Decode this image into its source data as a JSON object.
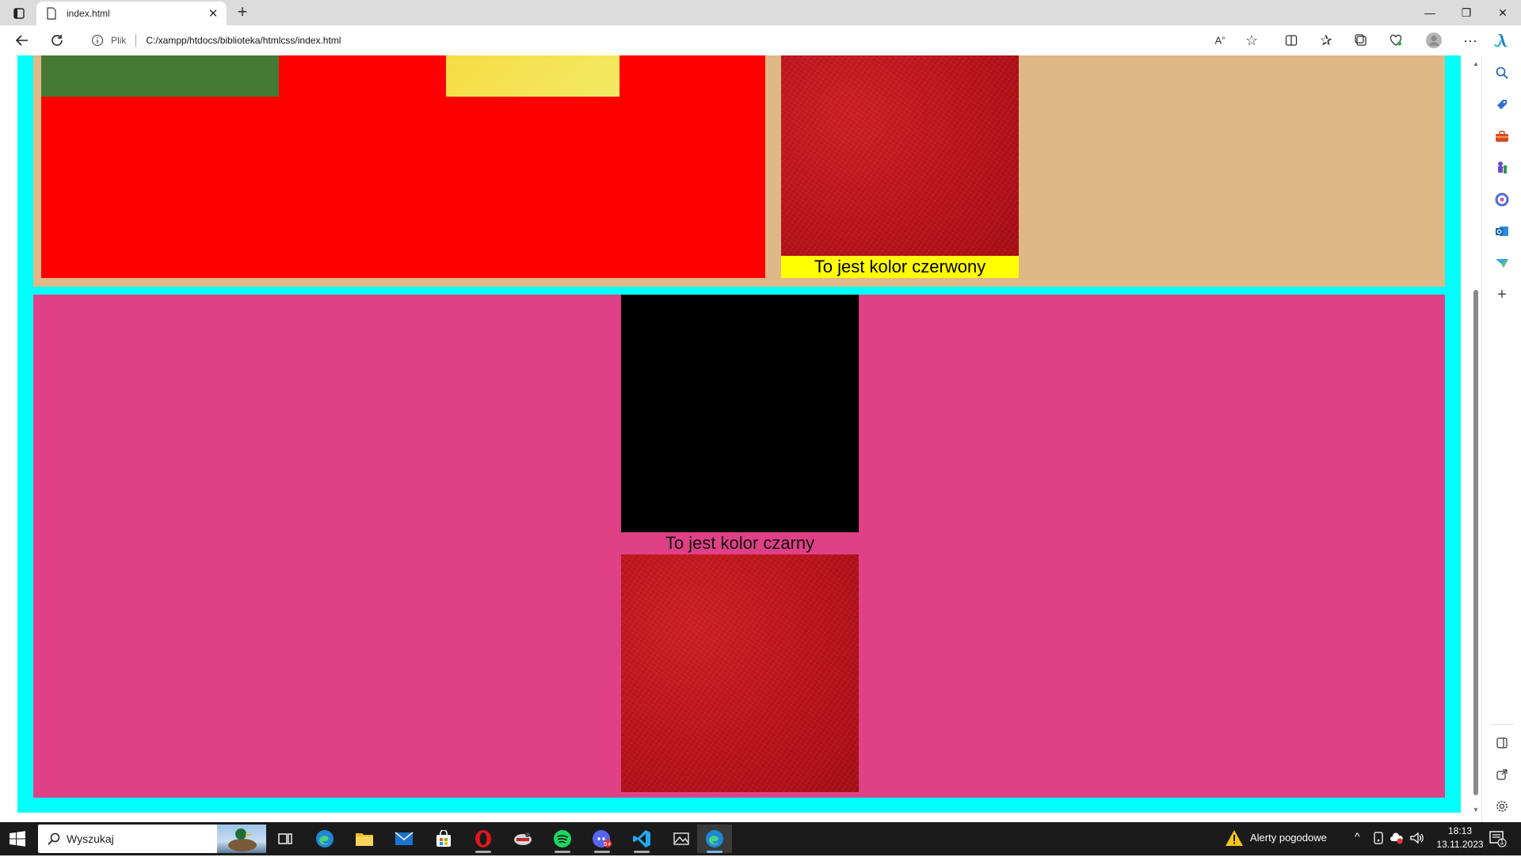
{
  "browser": {
    "tab": {
      "title": "index.html"
    },
    "address": {
      "info_label": "Plik",
      "url": "C:/xampp/htdocs/biblioteka/htmlcss/index.html"
    }
  },
  "page": {
    "top_section": {
      "caption": "To jest kolor czerwony"
    },
    "bottom_section": {
      "caption": "To jest kolor czarny"
    },
    "colors": {
      "outer_border": "#00ffff",
      "top_bg": "#deb887",
      "red_block": "#ff0000",
      "green_block": "#457a35",
      "yellow_block": "#f5e25a",
      "caption_highlight": "#ffff00",
      "bottom_bg": "#e04086",
      "black_block": "#000000"
    }
  },
  "taskbar": {
    "search_placeholder": "Wyszukaj",
    "weather_alert": "Alerty pogodowe",
    "time": "18:13",
    "date": "13.11.2023",
    "notification_count": "1",
    "apps": [
      "task-view",
      "edge",
      "file-explorer",
      "mail",
      "store",
      "opera",
      "mission-app",
      "spotify",
      "discord",
      "vscode",
      "photo-app",
      "edge-active"
    ]
  }
}
